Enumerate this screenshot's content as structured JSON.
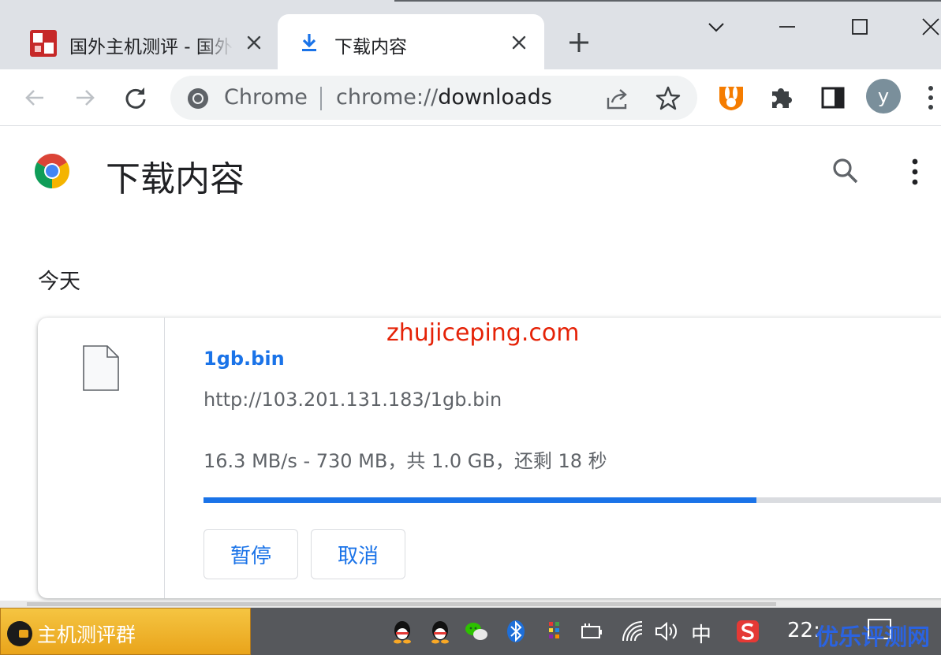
{
  "tabs": [
    {
      "title": "国外主机测评 - 国外",
      "active": false
    },
    {
      "title": "下载内容",
      "active": true
    }
  ],
  "omnibox": {
    "site_label": "Chrome",
    "url_scheme": "chrome://",
    "url_path": "downloads"
  },
  "profile": {
    "initial": "y"
  },
  "page": {
    "title": "下载内容",
    "section_date": "今天"
  },
  "download": {
    "file_name": "1gb.bin",
    "url": "http://103.201.131.183/1gb.bin",
    "status": "16.3 MB/s - 730 MB，共 1.0 GB，还剩 18 秒",
    "progress_fraction": 0.73,
    "pause_label": "暂停",
    "cancel_label": "取消"
  },
  "watermark": "zhujiceping.com",
  "taskbar": {
    "app_label": "主机测评群",
    "ime_label": "中",
    "clock": "22:",
    "corner_watermark": "优乐评测网"
  },
  "colors": {
    "accent": "#1a73e8",
    "watermark": "#e52207",
    "taskbar": "#56585c"
  },
  "icons": {
    "tab1": "site-favicon",
    "tab2": "download-icon",
    "toolbar": [
      "back-icon",
      "forward-icon",
      "reload-icon",
      "chrome-icon",
      "share-icon",
      "star-icon",
      "rabbit-extension-icon",
      "puzzle-icon",
      "side-panel-icon",
      "kebab-menu-icon"
    ],
    "tray": [
      "qq-icon",
      "qq-icon",
      "wechat-icon",
      "bluetooth-icon",
      "color-grid-icon",
      "power-icon",
      "wifi-icon",
      "volume-icon",
      "sogou-icon"
    ]
  }
}
